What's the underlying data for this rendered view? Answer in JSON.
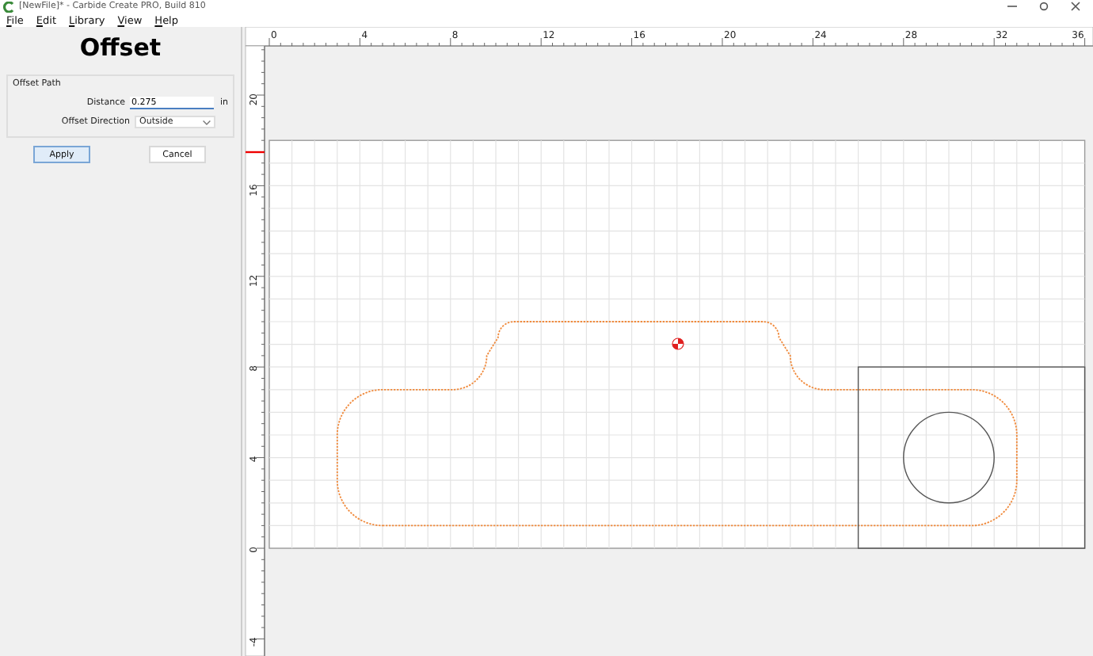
{
  "window": {
    "title": "[NewFile]* - Carbide Create PRO, Build 810"
  },
  "menu": [
    {
      "label": "File"
    },
    {
      "label": "Edit"
    },
    {
      "label": "Library"
    },
    {
      "label": "View"
    },
    {
      "label": "Help"
    }
  ],
  "panel": {
    "heading": "Offset",
    "group": "Offset Path",
    "fields": [
      {
        "kind": "text",
        "label": "Distance",
        "value": "0.275",
        "unit": "in"
      },
      {
        "kind": "select",
        "label": "Offset Direction",
        "value": "Outside"
      }
    ],
    "buttons": [
      {
        "label": "Apply",
        "selected": true
      },
      {
        "label": "Cancel",
        "selected": false
      }
    ]
  },
  "rulers": {
    "x_labels": [
      "0",
      "4",
      "8",
      "12",
      "16",
      "20",
      "24",
      "28",
      "32",
      "36"
    ],
    "y_labels": [
      "20",
      "16",
      "12",
      "8",
      "4",
      "0",
      "-4"
    ]
  }
}
